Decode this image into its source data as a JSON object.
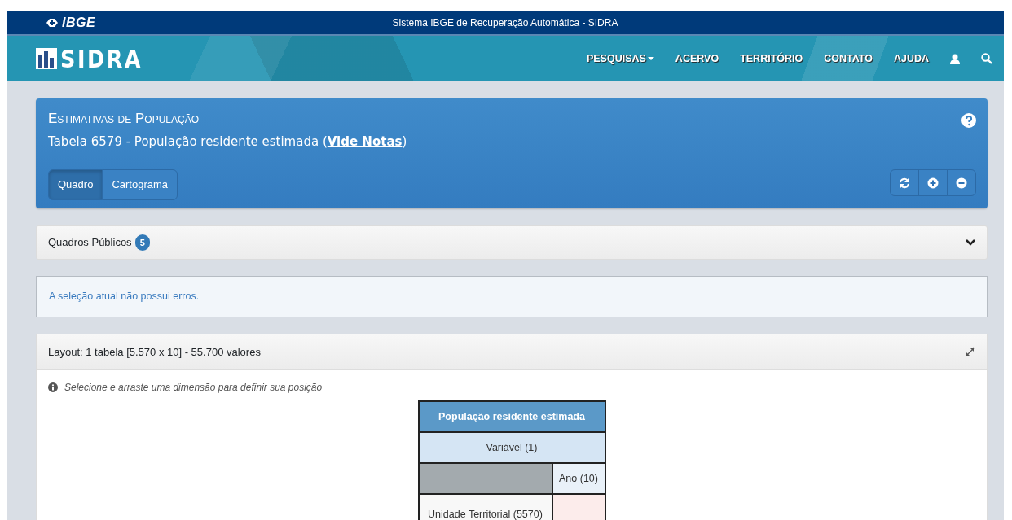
{
  "brand": {
    "org": "IBGE",
    "app": "SIDRA"
  },
  "topbar": {
    "title": "Sistema IBGE de Recuperação Automática - SIDRA"
  },
  "nav": {
    "items": [
      {
        "label": "PESQUISAS",
        "dropdown": true
      },
      {
        "label": "ACERVO",
        "dropdown": false
      },
      {
        "label": "TERRITÓRIO",
        "dropdown": false
      },
      {
        "label": "CONTATO",
        "dropdown": false
      },
      {
        "label": "AJUDA",
        "dropdown": false
      }
    ]
  },
  "header": {
    "title": "Estimativas de População",
    "subtitle": "Tabela 6579 - População residente estimada (",
    "notes_link": "Vide Notas",
    "subtitle_end": ")"
  },
  "view_tabs": [
    {
      "label": "Quadro",
      "selected": true
    },
    {
      "label": "Cartograma",
      "selected": false
    }
  ],
  "public_tables": {
    "label": "Quadros Públicos",
    "count": "5",
    "expanded": false
  },
  "status_message": "A seleção atual não possui erros.",
  "layout": {
    "title": "Layout: 1 tabela [5.570 x 10] - 55.700 valores",
    "hint": "Selecione e arraste uma dimensão para definir sua posição",
    "pivot": {
      "header": "População residente estimada",
      "variable": "Variável (1)",
      "column_dimension": "Ano (10)",
      "row_dimension": "Unidade Territorial (5570)"
    }
  }
}
